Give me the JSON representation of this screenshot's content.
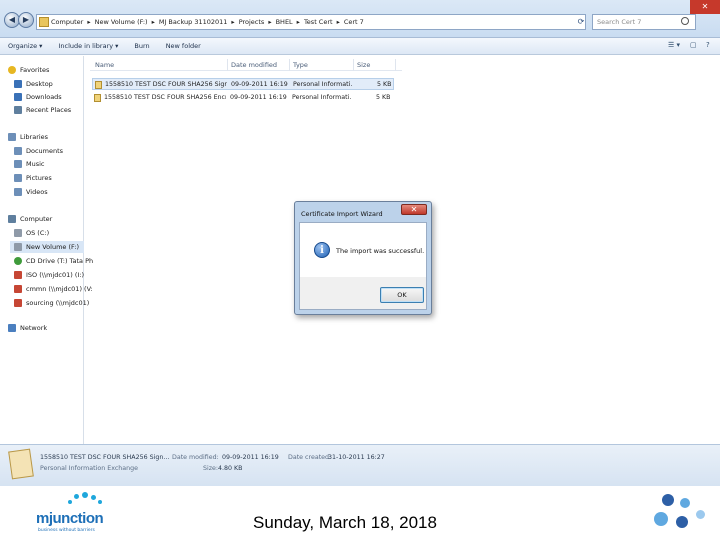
{
  "address_bar": {
    "crumbs": [
      "Computer",
      "New Volume (F:)",
      "MJ Backup 31102011",
      "Projects",
      "BHEL",
      "Test Cert",
      "Cert 7"
    ],
    "search_placeholder": "Search Cert 7"
  },
  "toolbar": {
    "organize": "Organize ▾",
    "include": "Include in library ▾",
    "burn": "Burn",
    "new_folder": "New folder"
  },
  "nav_pane": {
    "favorites": "Favorites",
    "desktop": "Desktop",
    "downloads": "Downloads",
    "recent": "Recent Places",
    "libraries": "Libraries",
    "documents": "Documents",
    "music": "Music",
    "pictures": "Pictures",
    "videos": "Videos",
    "computer": "Computer",
    "os_c": "OS (C:)",
    "new_volume": "New Volume (F:)",
    "cd_drive": "CD Drive (T:) Tata Ph",
    "iso": "ISO (\\\\mjdc01) (I:)",
    "cmmn": "cmmn (\\\\mjdc01) (V:",
    "sourcing": "sourcing (\\\\mjdc01)",
    "network": "Network"
  },
  "columns": {
    "name": "Name",
    "date": "Date modified",
    "type": "Type",
    "size": "Size"
  },
  "files": [
    {
      "name": "1558510 TEST DSC FOUR SHA256 Sign...",
      "date": "09-09-2011 16:19",
      "type": "Personal Informati...",
      "size": "5 KB"
    },
    {
      "name": "1558510 TEST DSC FOUR SHA256 Encryp...",
      "date": "09-09-2011 16:19",
      "type": "Personal Informati...",
      "size": "5 KB"
    }
  ],
  "dialog": {
    "title": "Certificate Import Wizard",
    "close": "✕",
    "message": "The import was successful.",
    "ok": "OK"
  },
  "details": {
    "filename": "1558510 TEST DSC FOUR SHA256 Sign...",
    "date_modified_label": "Date modified:",
    "date_modified": "09-09-2011 16:19",
    "date_created_label": "Date created:",
    "date_created": "31-10-2011 16:27",
    "type": "Personal Information Exchange",
    "size_label": "Size:",
    "size": "4.80 KB"
  },
  "footer": {
    "logo_text": "mjunction",
    "logo_tagline": "business without barriers",
    "date": "Sunday, March 18, 2018"
  },
  "colors": {
    "accent": "#3a71b7",
    "logo_blue": "#1d6fb7",
    "logo_cyan": "#1fa7dc"
  }
}
